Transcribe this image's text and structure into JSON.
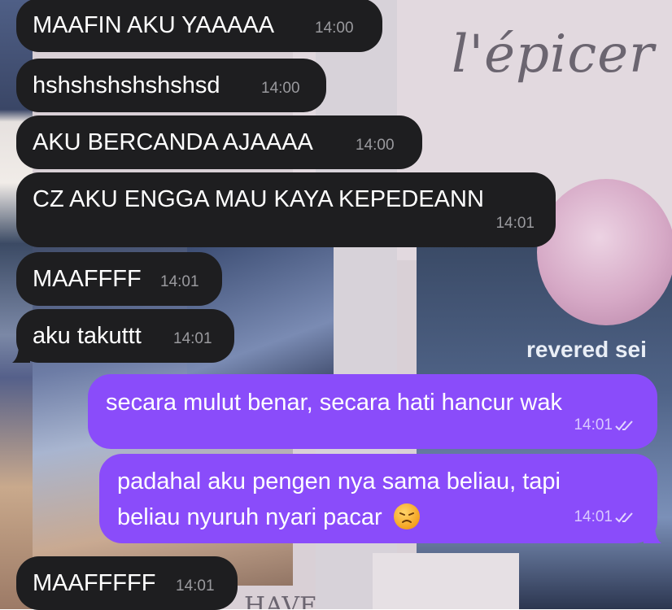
{
  "messages": [
    {
      "dir": "in",
      "text": "MAAFIN AKU YAAAAA",
      "time": "14:00"
    },
    {
      "dir": "in",
      "text": "hshshshshshshsd",
      "time": "14:00"
    },
    {
      "dir": "in",
      "text": "AKU BERCANDA AJAAAA",
      "time": "14:00"
    },
    {
      "dir": "in",
      "text": "CZ AKU ENGGA MAU KAYA KEPEDEANN",
      "time": "14:01"
    },
    {
      "dir": "in",
      "text": "MAAFFFF",
      "time": "14:01"
    },
    {
      "dir": "in",
      "text": "aku takuttt",
      "time": "14:01"
    },
    {
      "dir": "out",
      "text": "secara mulut benar, secara hati hancur wak",
      "time": "14:01",
      "status": "read"
    },
    {
      "dir": "out",
      "line1": "padahal aku pengen nya sama beliau, tapi",
      "line2": "beliau nyuruh nyari pacar",
      "emoji": "disappointed-face",
      "time": "14:01",
      "status": "read"
    },
    {
      "dir": "in",
      "text": "MAAFFFFF",
      "time": "14:01"
    }
  ],
  "wallpaper": {
    "script_text": "l'épicer",
    "game_label": "revered sei",
    "handwriting": "HAVE"
  },
  "colors": {
    "incoming_bubble": "#1e1e20",
    "outgoing_bubble": "#8a4cfa",
    "text": "#ffffff"
  }
}
